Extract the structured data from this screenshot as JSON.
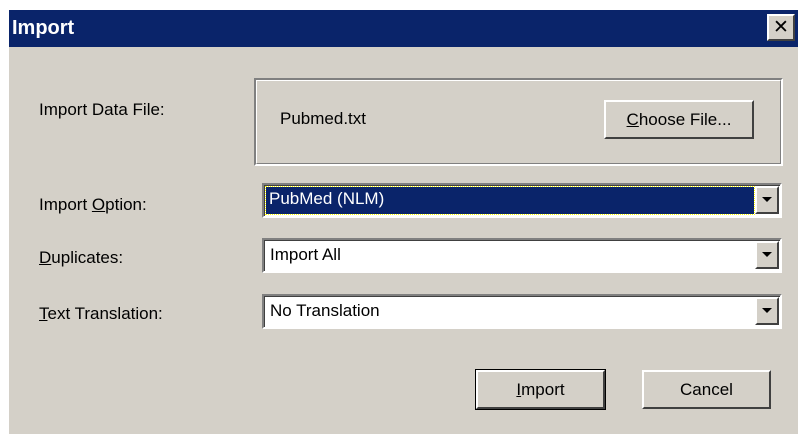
{
  "window": {
    "title": "Import",
    "close_glyph": "✕"
  },
  "file": {
    "label": "Import Data File:",
    "filename": "Pubmed.txt",
    "choose_button": {
      "mnemonic": "C",
      "rest": "hoose File..."
    }
  },
  "import_option": {
    "label_before": "Import ",
    "label_mnemonic": "O",
    "label_after": "ption:",
    "value": "PubMed (NLM)"
  },
  "duplicates": {
    "label_mnemonic": "D",
    "label_after": "uplicates:",
    "value": "Import All"
  },
  "text_translation": {
    "label_mnemonic": "T",
    "label_after": "ext Translation:",
    "value": "No Translation"
  },
  "buttons": {
    "import": {
      "mnemonic": "I",
      "rest": "mport"
    },
    "cancel": "Cancel"
  },
  "icons": {
    "close": "close-icon",
    "dropdown": "chevron-down-icon"
  },
  "colors": {
    "titlebar": "#0a246a",
    "face": "#d4d0c8",
    "selection": "#0a246a"
  }
}
